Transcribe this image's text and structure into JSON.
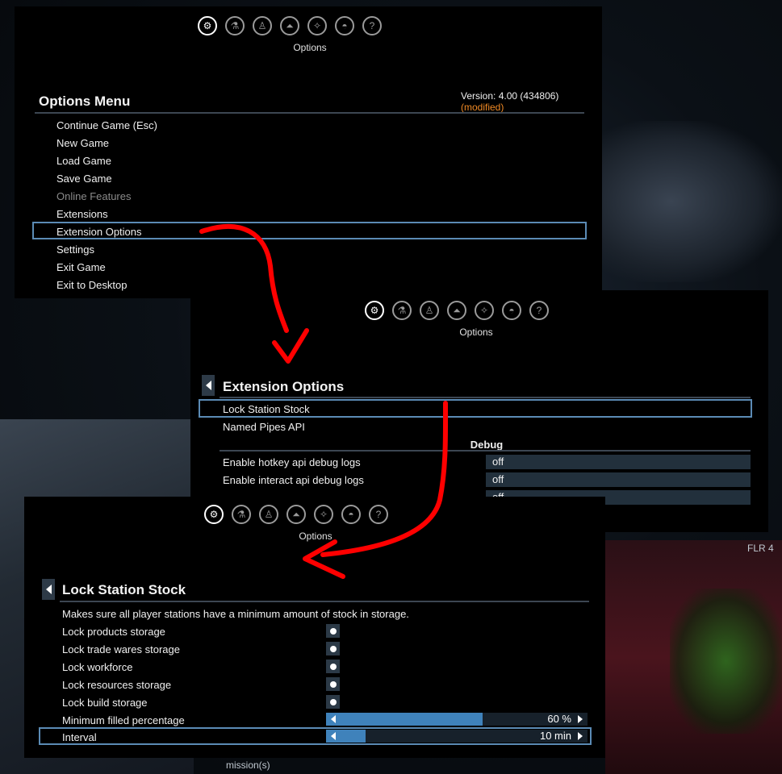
{
  "tab_caption": "Options",
  "icons": [
    "gear-icon",
    "flask-icon",
    "person-icon",
    "ship-icon",
    "star-map-icon",
    "encyclopedia-icon",
    "help-icon"
  ],
  "colors": {
    "highlight": "#5b8bb5",
    "slider_fill": "#3f82bb",
    "modified": "#f08a24",
    "arrow": "#ff0000"
  },
  "options_menu": {
    "title": "Options Menu",
    "version": "Version: 4.00 (434806)",
    "modified": "(modified)",
    "items": [
      {
        "label": "Continue Game (Esc)",
        "enabled": true
      },
      {
        "label": "New Game",
        "enabled": true
      },
      {
        "label": "Load Game",
        "enabled": true
      },
      {
        "label": "Save Game",
        "enabled": true
      },
      {
        "label": "Online Features",
        "enabled": false
      },
      {
        "label": "Extensions",
        "enabled": true
      },
      {
        "label": "Extension Options",
        "enabled": true,
        "selected": true
      },
      {
        "label": "Settings",
        "enabled": true
      },
      {
        "label": "Exit Game",
        "enabled": true
      },
      {
        "label": "Exit to Desktop",
        "enabled": true
      }
    ]
  },
  "extension_options": {
    "title": "Extension Options",
    "items": [
      {
        "label": "Lock Station Stock",
        "selected": true
      },
      {
        "label": "Named Pipes API"
      }
    ],
    "section": "Debug",
    "debug": [
      {
        "label": "Enable hotkey api debug logs",
        "value": "off"
      },
      {
        "label": "Enable interact api debug logs",
        "value": "off"
      },
      {
        "label": "",
        "value": "off"
      }
    ]
  },
  "lock_station_stock": {
    "title": "Lock Station Stock",
    "description": "Makes sure all player stations have a minimum amount of stock in storage.",
    "toggles": [
      {
        "label": "Lock products storage",
        "checked": true
      },
      {
        "label": "Lock trade wares storage",
        "checked": true
      },
      {
        "label": "Lock workforce",
        "checked": true
      },
      {
        "label": "Lock resources storage",
        "checked": true
      },
      {
        "label": "Lock build storage",
        "checked": true
      }
    ],
    "sliders": [
      {
        "label": "Minimum filled percentage",
        "value": "60 %",
        "fraction": 0.6
      },
      {
        "label": "Interval",
        "value": "10 min",
        "fraction": 0.15,
        "selected": true
      }
    ]
  },
  "hud": {
    "floor": "FLR 4",
    "mission": "mission(s)"
  }
}
